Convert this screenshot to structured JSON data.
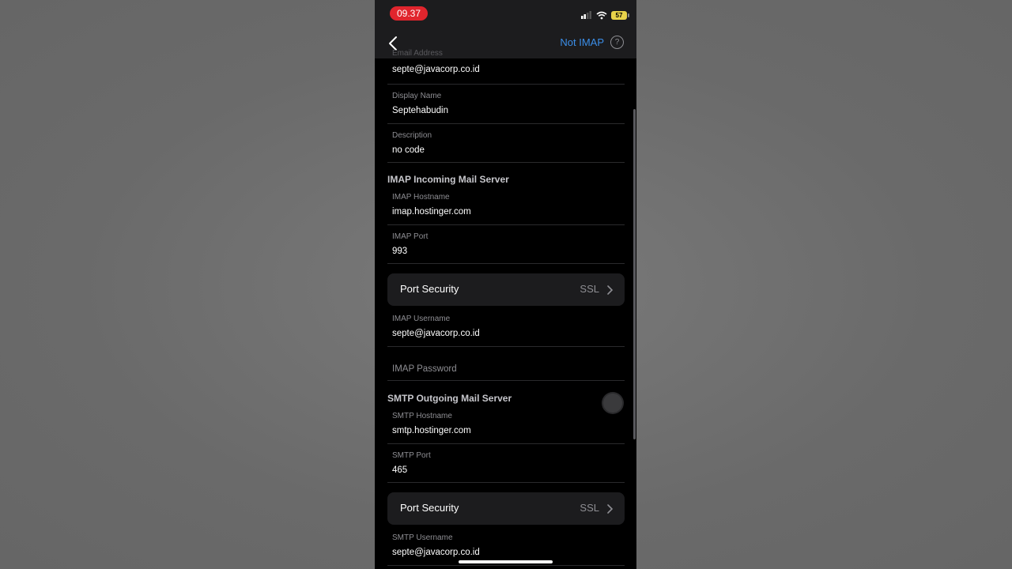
{
  "status_bar": {
    "time": "09.37",
    "battery": "57"
  },
  "nav": {
    "right_label": "Not IMAP",
    "help_glyph": "?"
  },
  "account": {
    "email_label": "Email Address",
    "email_value": "septe@javacorp.co.id",
    "display_name_label": "Display Name",
    "display_name_value": "Septehabudin",
    "description_label": "Description",
    "description_value": "no code"
  },
  "imap": {
    "header": "IMAP Incoming Mail Server",
    "hostname_label": "IMAP Hostname",
    "hostname_value": "imap.hostinger.com",
    "port_label": "IMAP Port",
    "port_value": "993",
    "security_label": "Port Security",
    "security_value": "SSL",
    "username_label": "IMAP Username",
    "username_value": "septe@javacorp.co.id",
    "password_placeholder": "IMAP Password"
  },
  "smtp": {
    "header": "SMTP Outgoing Mail Server",
    "hostname_label": "SMTP Hostname",
    "hostname_value": "smtp.hostinger.com",
    "port_label": "SMTP Port",
    "port_value": "465",
    "security_label": "Port Security",
    "security_value": "SSL",
    "username_label": "SMTP Username",
    "username_value": "septe@javacorp.co.id"
  },
  "icons": {
    "back": "chevron-left-icon",
    "help": "question-circle-icon",
    "chevron": "chevron-right-icon",
    "signal": "cellular-signal-icon",
    "wifi": "wifi-icon",
    "battery": "battery-icon"
  },
  "colors": {
    "accent": "#3b8ee8",
    "time_pill": "#e0252d",
    "battery": "#e8d34a",
    "card": "#1c1c1e",
    "secondary_text": "#8e8e93"
  }
}
